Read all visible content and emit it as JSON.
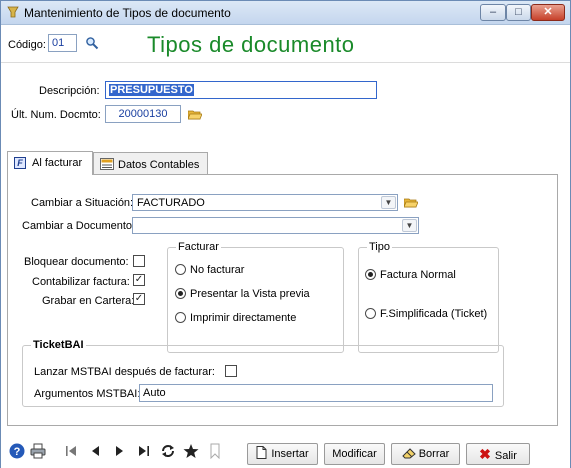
{
  "window": {
    "title": "Mantenimiento de Tipos de documento",
    "minimize_glyph": "–",
    "maximize_glyph": "□",
    "close_glyph": "✕"
  },
  "header": {
    "codigo_label": "Código:",
    "codigo_value": "01",
    "heading": "Tipos de documento"
  },
  "form": {
    "descripcion_label": "Descripción:",
    "descripcion_value": "PRESUPUESTO",
    "ult_num_label": "Últ. Num. Docmto:",
    "ult_num_value": "20000130"
  },
  "tabs": [
    {
      "label": "Al facturar",
      "icon_glyph": "F",
      "active": true
    },
    {
      "label": "Datos Contables",
      "active": false
    }
  ],
  "al_facturar": {
    "cambiar_situacion_label": "Cambiar a Situación:",
    "cambiar_situacion_value": "FACTURADO",
    "cambiar_documento_label": "Cambiar a Documento:",
    "cambiar_documento_value": "",
    "bloquear_label": "Bloquear documento:",
    "bloquear_checked": false,
    "contabilizar_label": "Contabilizar factura:",
    "contabilizar_checked": true,
    "grabar_label": "Grabar en Cartera:",
    "grabar_checked": true,
    "check_glyph": "✓",
    "facturar_group": {
      "legend": "Facturar",
      "options": [
        "No facturar",
        "Presentar la Vista previa",
        "Imprimir directamente"
      ],
      "selected": 1
    },
    "tipo_group": {
      "legend": "Tipo",
      "options": [
        "Factura Normal",
        "F.Simplificada (Ticket)"
      ],
      "selected": 0
    },
    "ticketbai": {
      "legend": "TicketBAI",
      "lanzar_label": "Lanzar MSTBAI después de facturar:",
      "lanzar_checked": false,
      "argumentos_label": "Argumentos MSTBAI:",
      "argumentos_value": "Auto"
    }
  },
  "toolbar": {
    "icons": [
      "help-icon",
      "print-icon",
      "first-record-icon",
      "previous-record-icon",
      "next-record-icon",
      "last-record-icon",
      "refresh-icon",
      "favorite-star-icon",
      "bookmark-icon"
    ],
    "insertar_label": "Insertar",
    "modificar_label": "Modificar",
    "borrar_label": "Borrar",
    "salir_label": "Salir"
  },
  "colors": {
    "heading_green": "#1a8a2a",
    "selection_blue": "#3366cc",
    "ult_num_text": "#1a3fa0",
    "salir_red": "#cc1111"
  }
}
